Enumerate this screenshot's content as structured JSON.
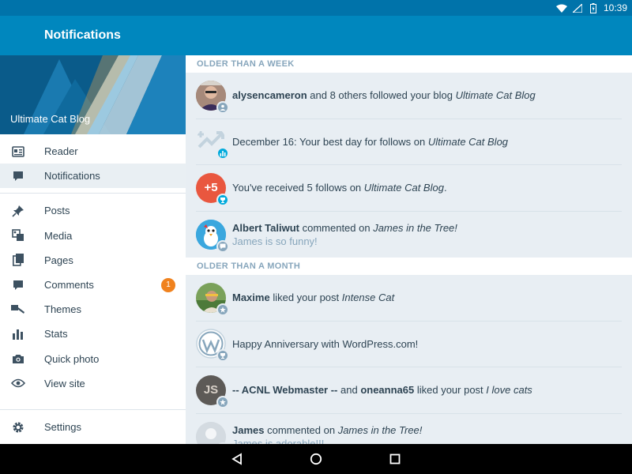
{
  "status": {
    "time": "10:39"
  },
  "app_bar": {
    "title": "Notifications"
  },
  "drawer": {
    "blog_title": "Ultimate Cat Blog",
    "primary": [
      {
        "label": "Reader",
        "icon": "reader-icon"
      },
      {
        "label": "Notifications",
        "icon": "notifications-icon"
      }
    ],
    "secondary": [
      {
        "label": "Posts",
        "icon": "pin-icon"
      },
      {
        "label": "Media",
        "icon": "media-icon"
      },
      {
        "label": "Pages",
        "icon": "pages-icon"
      },
      {
        "label": "Comments",
        "icon": "comment-icon",
        "badge": "1"
      },
      {
        "label": "Themes",
        "icon": "brush-icon"
      },
      {
        "label": "Stats",
        "icon": "stats-icon"
      },
      {
        "label": "Quick photo",
        "icon": "camera-icon"
      },
      {
        "label": "View site",
        "icon": "eye-icon"
      }
    ],
    "settings": {
      "label": "Settings",
      "icon": "gear-icon"
    }
  },
  "sections": [
    {
      "title": "OLDER THAN A WEEK",
      "notes": [
        {
          "pre": "",
          "bold": "alysencameron",
          "mid": " and 8 others followed your blog ",
          "italic": "Ultimate Cat Blog",
          "post": "",
          "sub": ""
        },
        {
          "pre": "December 16: Your best day for follows on ",
          "bold": "",
          "mid": "",
          "italic": "Ultimate Cat Blog",
          "post": "",
          "sub": ""
        },
        {
          "pre": "You've received 5 follows on ",
          "bold": "",
          "mid": "",
          "italic": "Ultimate Cat Blog",
          "post": ".",
          "sub": ""
        },
        {
          "pre": "",
          "bold": "Albert Taliwut",
          "mid": " commented on ",
          "italic": "James in the Tree!",
          "post": "",
          "sub": "James is so funny!"
        }
      ]
    },
    {
      "title": "OLDER THAN A MONTH",
      "notes": [
        {
          "pre": "",
          "bold": "Maxime",
          "mid": " liked your post ",
          "italic": "Intense Cat",
          "post": "",
          "sub": ""
        },
        {
          "pre": "Happy Anniversary with WordPress.com!",
          "bold": "",
          "mid": "",
          "italic": "",
          "post": "",
          "sub": ""
        },
        {
          "pre": "",
          "bold": "-- ACNL Webmaster --",
          "mid": " and ",
          "bold2": "oneanna65",
          "mid2": " liked your post ",
          "italic": "I love cats",
          "post": "",
          "sub": ""
        },
        {
          "pre": "",
          "bold": "James",
          "mid": " commented on ",
          "italic": "James in the Tree!",
          "post": "",
          "sub": "James is adorable!!!"
        }
      ]
    }
  ],
  "badge_avatars": {
    "follows_count": "+5",
    "initials": "JS"
  },
  "colors": {
    "status_bar": "#0073aa",
    "app_bar": "#0087be",
    "accent_orange": "#f0821e",
    "badge_blue": "#00aadc"
  }
}
